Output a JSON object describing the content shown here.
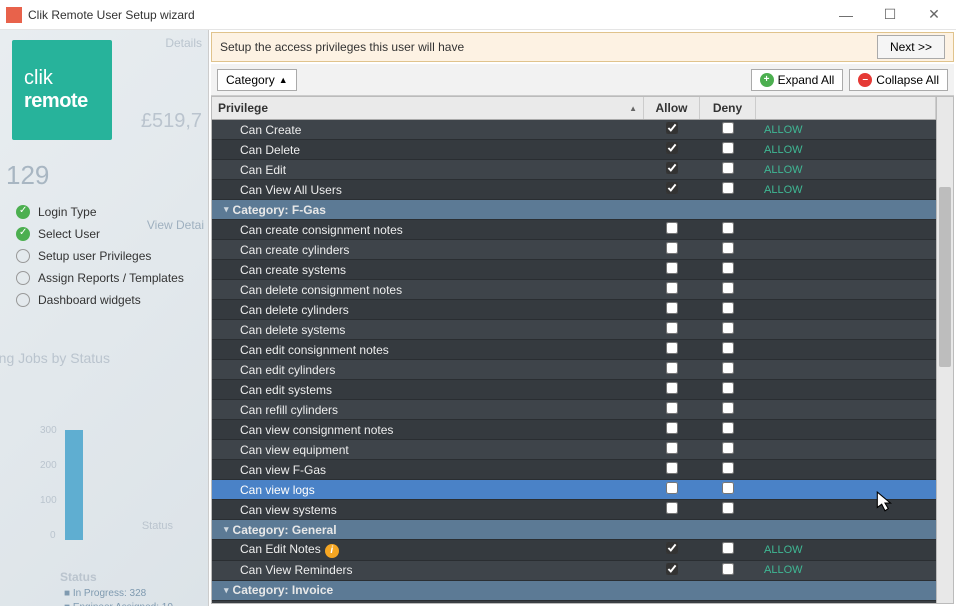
{
  "window": {
    "title": "Clik Remote User Setup wizard"
  },
  "logo": {
    "line1": "clik",
    "line2": "remote"
  },
  "steps": [
    {
      "label": "Login Type",
      "done": true
    },
    {
      "label": "Select User",
      "done": true
    },
    {
      "label": "Setup user Privileges",
      "done": false
    },
    {
      "label": "Assign Reports / Templates",
      "done": false
    },
    {
      "label": "Dashboard widgets",
      "done": false
    }
  ],
  "instruction": "Setup the access privileges this user will have",
  "buttons": {
    "next": "Next >>",
    "category": "Category",
    "expand_all": "Expand All",
    "collapse_all": "Collapse All"
  },
  "columns": {
    "privilege": "Privilege",
    "allow": "Allow",
    "deny": "Deny"
  },
  "status_allow": "ALLOW",
  "rows": [
    {
      "type": "priv",
      "label": "Can Create",
      "allow": true,
      "deny": false,
      "status": "ALLOW"
    },
    {
      "type": "priv",
      "label": "Can Delete",
      "allow": true,
      "deny": false,
      "status": "ALLOW"
    },
    {
      "type": "priv",
      "label": "Can Edit",
      "allow": true,
      "deny": false,
      "status": "ALLOW"
    },
    {
      "type": "priv",
      "label": "Can View All Users",
      "allow": true,
      "deny": false,
      "status": "ALLOW"
    },
    {
      "type": "cat",
      "label": "Category: F-Gas"
    },
    {
      "type": "priv",
      "label": "Can create consignment notes",
      "allow": false,
      "deny": false,
      "status": ""
    },
    {
      "type": "priv",
      "label": "Can create cylinders",
      "allow": false,
      "deny": false,
      "status": ""
    },
    {
      "type": "priv",
      "label": "Can create systems",
      "allow": false,
      "deny": false,
      "status": ""
    },
    {
      "type": "priv",
      "label": "Can delete consignment notes",
      "allow": false,
      "deny": false,
      "status": ""
    },
    {
      "type": "priv",
      "label": "Can delete cylinders",
      "allow": false,
      "deny": false,
      "status": ""
    },
    {
      "type": "priv",
      "label": "Can delete systems",
      "allow": false,
      "deny": false,
      "status": ""
    },
    {
      "type": "priv",
      "label": "Can edit consignment notes",
      "allow": false,
      "deny": false,
      "status": ""
    },
    {
      "type": "priv",
      "label": "Can edit cylinders",
      "allow": false,
      "deny": false,
      "status": ""
    },
    {
      "type": "priv",
      "label": "Can edit systems",
      "allow": false,
      "deny": false,
      "status": ""
    },
    {
      "type": "priv",
      "label": "Can refill cylinders",
      "allow": false,
      "deny": false,
      "status": ""
    },
    {
      "type": "priv",
      "label": "Can view consignment notes",
      "allow": false,
      "deny": false,
      "status": ""
    },
    {
      "type": "priv",
      "label": "Can view equipment",
      "allow": false,
      "deny": false,
      "status": ""
    },
    {
      "type": "priv",
      "label": "Can view F-Gas",
      "allow": false,
      "deny": false,
      "status": ""
    },
    {
      "type": "priv",
      "label": "Can view logs",
      "allow": false,
      "deny": false,
      "status": "",
      "selected": true
    },
    {
      "type": "priv",
      "label": "Can view systems",
      "allow": false,
      "deny": false,
      "status": ""
    },
    {
      "type": "cat",
      "label": "Category: General"
    },
    {
      "type": "priv",
      "label": "Can Edit Notes",
      "allow": true,
      "deny": false,
      "status": "ALLOW",
      "info": true
    },
    {
      "type": "priv",
      "label": "Can View Reminders",
      "allow": true,
      "deny": false,
      "status": "ALLOW"
    },
    {
      "type": "cat",
      "label": "Category: Invoice"
    }
  ]
}
